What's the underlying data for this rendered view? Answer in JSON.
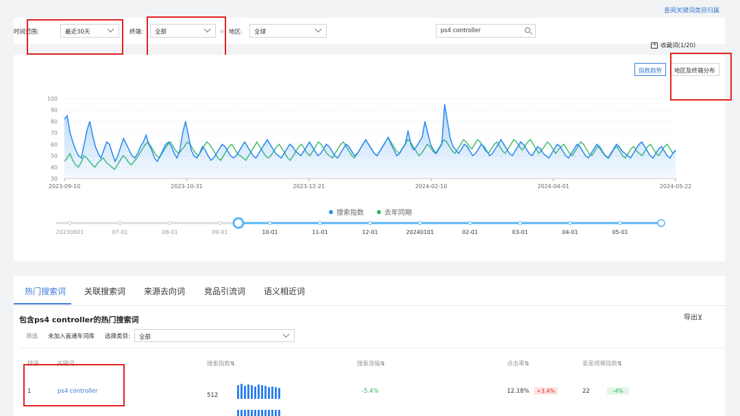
{
  "top_link": "查阅关键词类目归属",
  "filters": {
    "time_label": "时间范围:",
    "time_value": "最近30天",
    "terminal_label": "终端:",
    "terminal_value": "全部",
    "region_label": "地区:",
    "region_value": "全球",
    "search_value": "ps4 controller"
  },
  "favorites": "收藏词(1/20)",
  "view_buttons": {
    "trend": "指数趋势",
    "region": "地区及终端分布"
  },
  "chart_data": {
    "type": "area",
    "ylim": [
      30,
      100
    ],
    "yticks": [
      30,
      40,
      50,
      60,
      70,
      80,
      90,
      100
    ],
    "x_labels": [
      "2023-09-10",
      "2023-10-31",
      "2023-12-21",
      "2024-02-10",
      "2024-04-01",
      "2024-05-22"
    ],
    "series": [
      {
        "name": "搜索指数",
        "color": "#2d8cf0",
        "values": [
          82,
          85,
          70,
          62,
          55,
          50,
          48,
          60,
          72,
          80,
          68,
          58,
          52,
          48,
          55,
          62,
          60,
          52,
          45,
          50,
          58,
          65,
          60,
          55,
          50,
          48,
          52,
          58,
          62,
          68,
          60,
          55,
          48,
          45,
          50,
          55,
          60,
          62,
          58,
          52,
          48,
          55,
          70,
          80,
          68,
          55,
          50,
          48,
          52,
          58,
          55,
          50,
          46,
          48,
          52,
          56,
          60,
          58,
          54,
          50,
          48,
          50,
          54,
          58,
          62,
          58,
          54,
          50,
          48,
          52,
          56,
          60,
          64,
          60,
          56,
          52,
          50,
          48,
          52,
          56,
          60,
          58,
          54,
          52,
          50,
          54,
          58,
          62,
          58,
          54,
          50,
          52,
          56,
          60,
          58,
          54,
          50,
          48,
          52,
          56,
          60,
          58,
          54,
          50,
          52,
          56,
          60,
          64,
          60,
          56,
          52,
          50,
          54,
          58,
          62,
          66,
          60,
          55,
          50,
          52,
          56,
          60,
          72,
          60,
          55,
          58,
          62,
          66,
          80,
          70,
          60,
          55,
          52,
          56,
          60,
          95,
          80,
          65,
          58,
          55,
          52,
          56,
          60,
          58,
          54,
          50,
          52,
          56,
          60,
          58,
          54,
          50,
          52,
          56,
          60,
          64,
          60,
          56,
          52,
          50,
          54,
          58,
          62,
          60,
          56,
          52,
          50,
          54,
          58,
          56,
          52,
          50,
          48,
          52,
          56,
          60,
          58,
          54,
          50,
          48,
          52,
          56,
          60,
          58,
          54,
          50,
          48,
          52,
          56,
          60,
          58,
          54,
          50,
          48,
          52,
          56,
          60,
          58,
          54,
          52,
          50,
          48,
          52,
          56,
          60,
          62,
          58,
          54,
          50,
          48,
          52,
          56,
          58,
          54,
          50,
          48,
          52,
          55
        ]
      },
      {
        "name": "去年同期",
        "color": "#2bb55b",
        "values": [
          45,
          48,
          52,
          46,
          42,
          40,
          44,
          50,
          48,
          45,
          42,
          40,
          44,
          46,
          48,
          44,
          42,
          40,
          38,
          42,
          46,
          50,
          48,
          44,
          42,
          45,
          48,
          52,
          56,
          60,
          62,
          58,
          54,
          50,
          48,
          52,
          56,
          60,
          62,
          58,
          54,
          52,
          55,
          58,
          62,
          60,
          56,
          52,
          50,
          54,
          58,
          62,
          60,
          56,
          52,
          48,
          46,
          50,
          54,
          58,
          60,
          56,
          52,
          50,
          48,
          46,
          50,
          54,
          58,
          62,
          58,
          54,
          50,
          48,
          50,
          54,
          58,
          60,
          56,
          52,
          48,
          46,
          50,
          54,
          58,
          60,
          56,
          52,
          50,
          54,
          58,
          62,
          60,
          56,
          52,
          50,
          48,
          52,
          56,
          60,
          62,
          58,
          54,
          50,
          48,
          52,
          56,
          60,
          64,
          60,
          56,
          52,
          50,
          54,
          58,
          62,
          66,
          62,
          58,
          54,
          52,
          56,
          60,
          64,
          62,
          58,
          54,
          50,
          52,
          56,
          60,
          58,
          54,
          52,
          56,
          60,
          64,
          62,
          58,
          54,
          52,
          56,
          60,
          64,
          62,
          58,
          56,
          60,
          64,
          62,
          58,
          54,
          52,
          56,
          60,
          62,
          58,
          54,
          52,
          56,
          60,
          64,
          62,
          58,
          55,
          58,
          62,
          64,
          60,
          56,
          52,
          55,
          58,
          62,
          60,
          56,
          52,
          55,
          58,
          60,
          56,
          52,
          50,
          54,
          58,
          62,
          60,
          56,
          52,
          50,
          54,
          58,
          56,
          52,
          50,
          48,
          52,
          56,
          58,
          54,
          50,
          48,
          52,
          56,
          58,
          54,
          52,
          50,
          54,
          58,
          60,
          56,
          52,
          50,
          54,
          58,
          60,
          56,
          52,
          54
        ]
      }
    ],
    "legend": [
      "搜索指数",
      "去年同期"
    ],
    "timeline_labels": [
      "20230601",
      "07-01",
      "08-01",
      "09-01",
      "10-01",
      "11-01",
      "12-01",
      "20240101",
      "02-01",
      "03-01",
      "04-01",
      "05-01"
    ]
  },
  "tabs": [
    "热门搜索词",
    "关联搜索词",
    "来源去向词",
    "竞品引流词",
    "语义相近词"
  ],
  "section_title": "包含ps4 controller的热门搜索词",
  "export": "导出⊻",
  "sub_filter": {
    "screen_label": "筛选",
    "not_added": "未加入直通车词库",
    "category_label": "选择类目:",
    "category_value": "全部"
  },
  "table": {
    "headers": [
      "排序",
      "关键词",
      "搜索指数",
      "搜索涨幅",
      "点击率",
      "卖家规模指数"
    ],
    "row": {
      "rank": "1",
      "keyword": "ps4 controller",
      "search_index": "512",
      "search_growth": "-5.4%",
      "ctr": "12.18%",
      "ctr_change": "+3.4%",
      "seller_scale": "22",
      "seller_change": "-4%",
      "mini_bars": [
        20,
        22,
        19,
        21,
        20,
        18,
        21,
        20,
        19,
        17,
        18,
        17,
        16
      ]
    }
  }
}
